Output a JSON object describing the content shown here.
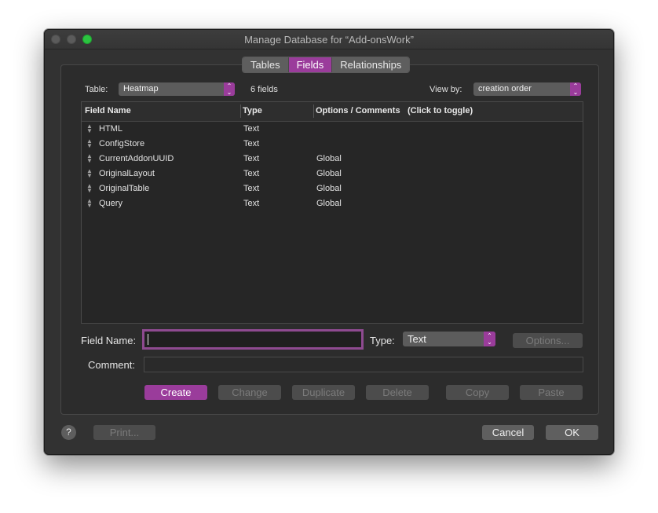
{
  "window": {
    "title": "Manage Database for “Add-onsWork”"
  },
  "tabs": [
    {
      "label": "Tables",
      "active": false
    },
    {
      "label": "Fields",
      "active": true
    },
    {
      "label": "Relationships",
      "active": false
    }
  ],
  "toolbar": {
    "table_label": "Table:",
    "table_value": "Heatmap",
    "field_count": "6 fields",
    "viewby_label": "View by:",
    "viewby_value": "creation order"
  },
  "columns": {
    "name": "Field Name",
    "type": "Type",
    "options": "Options / Comments",
    "toggle_hint": "(Click to toggle)"
  },
  "fields": [
    {
      "name": "HTML",
      "type": "Text",
      "options": ""
    },
    {
      "name": "ConfigStore",
      "type": "Text",
      "options": ""
    },
    {
      "name": "CurrentAddonUUID",
      "type": "Text",
      "options": "Global"
    },
    {
      "name": "OriginalLayout",
      "type": "Text",
      "options": "Global"
    },
    {
      "name": "OriginalTable",
      "type": "Text",
      "options": "Global"
    },
    {
      "name": "Query",
      "type": "Text",
      "options": "Global"
    }
  ],
  "editor": {
    "field_name_label": "Field Name:",
    "field_name_value": "",
    "type_label": "Type:",
    "type_value": "Text",
    "options_button": "Options...",
    "comment_label": "Comment:",
    "comment_value": ""
  },
  "actions": {
    "create": "Create",
    "change": "Change",
    "duplicate": "Duplicate",
    "delete": "Delete",
    "copy": "Copy",
    "paste": "Paste"
  },
  "footer": {
    "help": "?",
    "print": "Print...",
    "cancel": "Cancel",
    "ok": "OK"
  },
  "colors": {
    "accent": "#9a3c9b",
    "zoom_button": "#2bc440"
  }
}
